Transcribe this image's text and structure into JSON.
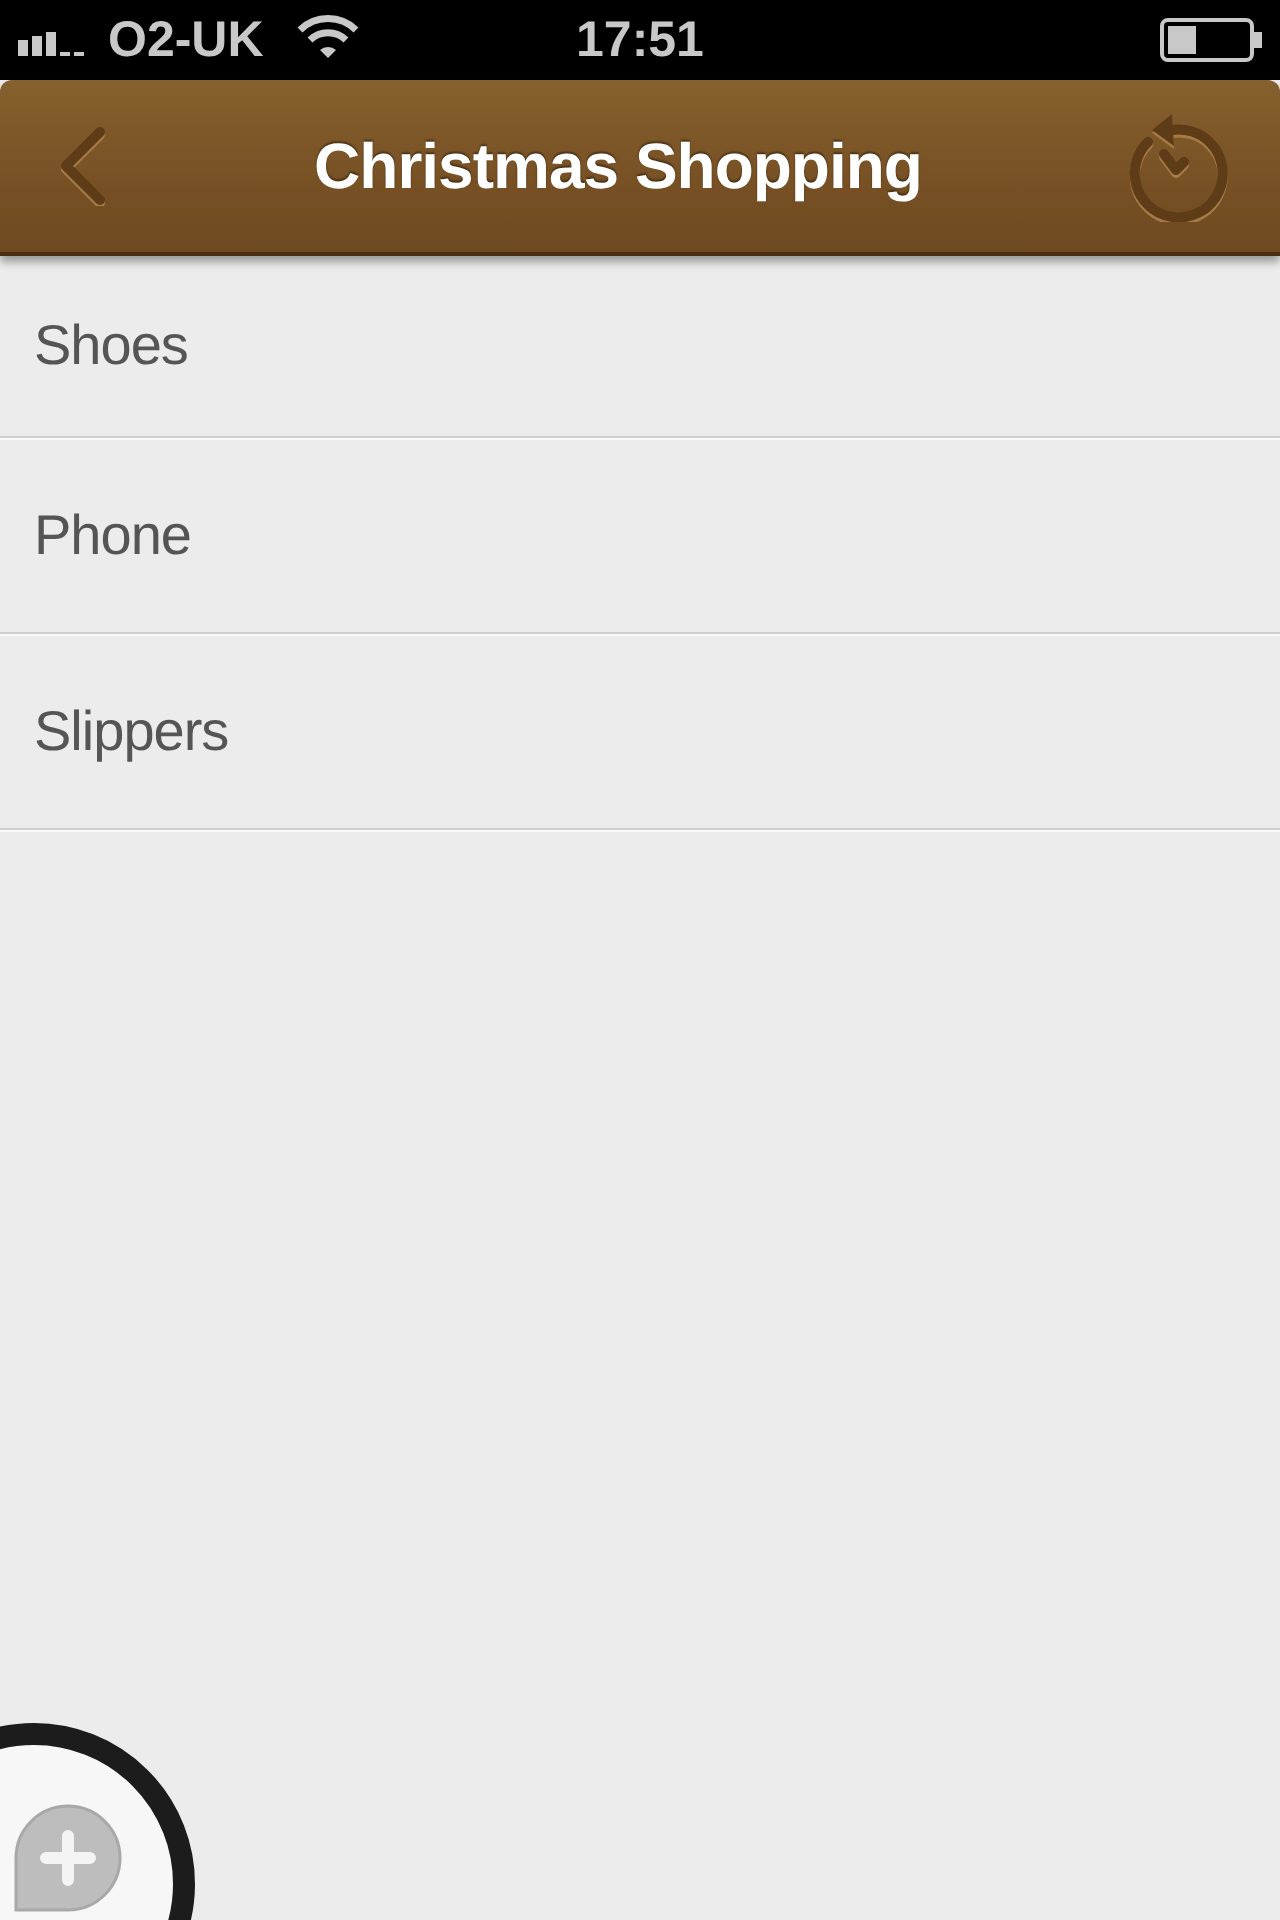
{
  "status_bar": {
    "carrier": "O2-UK",
    "time": "17:51"
  },
  "nav_bar": {
    "title": "Christmas Shopping"
  },
  "items": [
    {
      "label": "Shoes"
    },
    {
      "label": "Phone"
    },
    {
      "label": "Slippers"
    }
  ]
}
